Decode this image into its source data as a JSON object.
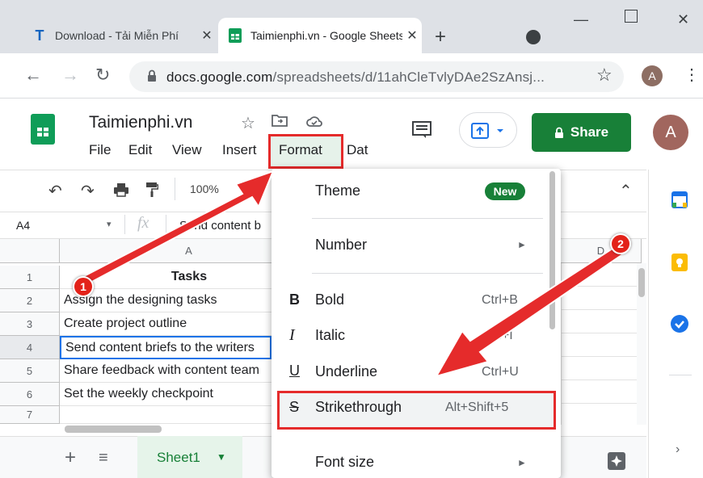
{
  "browser": {
    "tabs": [
      {
        "favicon": "T",
        "title": "Download - Tải Miễn Phí"
      },
      {
        "favicon": "sheets",
        "title": "Taimienphi.vn - Google Sheets"
      }
    ],
    "url_host": "docs.google.com",
    "url_path": "/spreadsheets/d/11ahCleTvlyDAe2SzAnsj...",
    "profile_initial": "A"
  },
  "doc": {
    "title": "Taimienphi.vn",
    "menus": [
      "File",
      "Edit",
      "View",
      "Insert",
      "Format",
      "Dat"
    ],
    "share_label": "Share",
    "avatar_initial": "A"
  },
  "toolbar": {
    "zoom": "100%"
  },
  "formula_bar": {
    "cell_ref": "A4",
    "fx": "fx",
    "content": "Send content b"
  },
  "grid": {
    "columns": [
      "A",
      "D"
    ],
    "rows": [
      {
        "num": "1",
        "value": "Tasks"
      },
      {
        "num": "2",
        "value": "Assign the designing tasks"
      },
      {
        "num": "3",
        "value": "Create project outline"
      },
      {
        "num": "4",
        "value": "Send content briefs to the writers"
      },
      {
        "num": "5",
        "value": "Share feedback with content team"
      },
      {
        "num": "6",
        "value": "Set the weekly checkpoint"
      },
      {
        "num": "7",
        "value": ""
      }
    ]
  },
  "sheet_tab": "Sheet1",
  "format_menu": {
    "theme": "Theme",
    "new_badge": "New",
    "number": "Number",
    "bold": {
      "label": "Bold",
      "shortcut": "Ctrl+B"
    },
    "italic": {
      "label": "Italic",
      "shortcut": "Ctrl+I"
    },
    "underline": {
      "label": "Underline",
      "shortcut": "Ctrl+U"
    },
    "strikethrough": {
      "label": "Strikethrough",
      "shortcut": "Alt+Shift+5"
    },
    "font_size": "Font size"
  },
  "annotations": [
    "1",
    "2"
  ],
  "colors": {
    "accent": "#188038",
    "annotation": "#e52b2b",
    "sheets_green": "#0f9d58"
  }
}
